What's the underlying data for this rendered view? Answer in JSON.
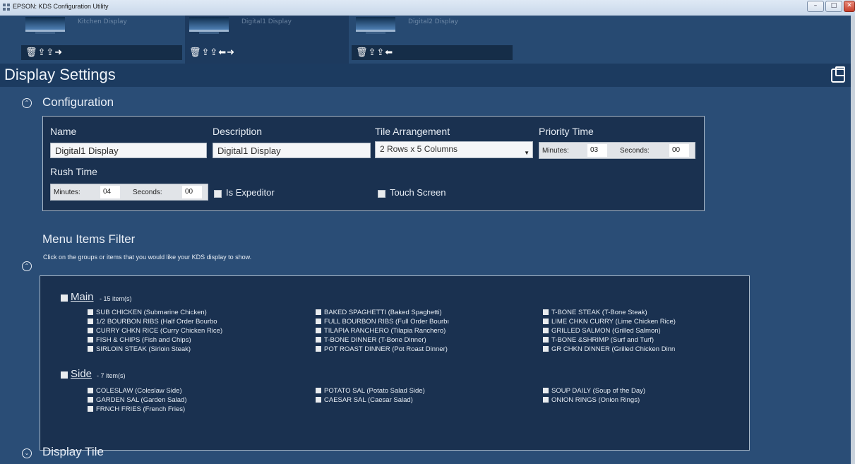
{
  "window": {
    "title": "EPSON: KDS Configuration Utility",
    "min": "–",
    "max": "□",
    "close": "✕"
  },
  "displays": [
    {
      "name": "Kitchen Display",
      "actions": "🗑⇪⇪➜"
    },
    {
      "name": "Digital1 Display",
      "actions": "🗑⇪⇪⬅➜"
    },
    {
      "name": "Digital2 Display",
      "actions": "🗑⇪⇪⬅"
    }
  ],
  "heading": "Display Settings",
  "configuration": {
    "title": "Configuration",
    "toggle": "⌃",
    "name_label": "Name",
    "name_value": "Digital1 Display",
    "description_label": "Description",
    "description_value": "Digital1 Display",
    "tile_label": "Tile Arrangement",
    "tile_value": "2 Rows x 5 Columns",
    "priority_label": "Priority Time",
    "priority_minutes_label": "Minutes:",
    "priority_minutes": "03",
    "priority_seconds_label": "Seconds:",
    "priority_seconds": "00",
    "rush_label": "Rush Time",
    "rush_minutes_label": "Minutes:",
    "rush_minutes": "04",
    "rush_seconds_label": "Seconds:",
    "rush_seconds": "00",
    "expeditor_label": "Is Expeditor",
    "touch_label": "Touch Screen"
  },
  "menu_filter": {
    "title": "Menu Items Filter",
    "subtitle": "Click on the groups or items that you would like your KDS display to show.",
    "toggle": "⌃",
    "groups": [
      {
        "name": "Main",
        "count": "- 15 item(s)",
        "columns": [
          [
            "SUB CHICKEN (Submarine Chicken)",
            "1/2 BOURBON RIBS (Half Order Bourbo",
            "CURRY CHKN RICE (Curry Chicken Rice)",
            "FISH & CHIPS (Fish and Chips)",
            "SIRLOIN STEAK (Sirloin Steak)"
          ],
          [
            "BAKED SPAGHETTI (Baked Spaghetti)",
            "FULL BOURBON RIBS (Full Order Bourbı",
            "TILAPIA RANCHERO (Tilapia Ranchero)",
            "T-BONE DINNER (T-Bone Dinner)",
            "POT ROAST DINNER (Pot Roast Dinner)"
          ],
          [
            "T-BONE STEAK (T-Bone Steak)",
            "LIME CHKN CURRY (Lime Chicken Rice)",
            "GRILLED SALMON (Grilled Salmon)",
            "T-BONE &SHRIMP (Surf and Turf)",
            "GR CHKN DINNER (Grilled Chicken Dinn"
          ]
        ]
      },
      {
        "name": "Side",
        "count": "- 7 item(s)",
        "columns": [
          [
            "COLESLAW (Coleslaw Side)",
            "GARDEN SAL (Garden Salad)",
            "FRNCH FRIES (French Fries)"
          ],
          [
            "POTATO SAL (Potato Salad Side)",
            "CAESAR SAL (Caesar Salad)"
          ],
          [
            "SOUP DAILY (Soup of the Day)",
            "ONION RINGS (Onion Rings)"
          ]
        ]
      }
    ]
  },
  "display_tile": {
    "title": "Display Tile",
    "toggle": "⌄"
  }
}
